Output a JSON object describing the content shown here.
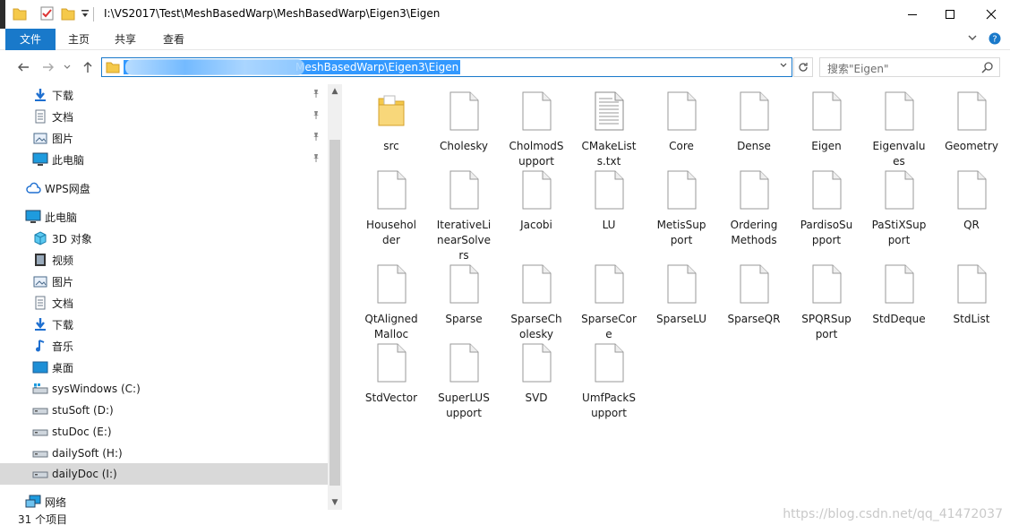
{
  "window": {
    "title": "I:\\VS2017\\Test\\MeshBasedWarp\\MeshBasedWarp\\Eigen3\\Eigen"
  },
  "ribbon": {
    "tabs": [
      "文件",
      "主页",
      "共享",
      "查看"
    ]
  },
  "address": {
    "path_visible": "MeshBasedWarp\\Eigen3\\Eigen"
  },
  "search": {
    "placeholder": "搜索\"Eigen\""
  },
  "sidebar": {
    "quick_access": [
      {
        "label": "下载",
        "icon": "download-arrow-icon"
      },
      {
        "label": "文档",
        "icon": "document-icon"
      },
      {
        "label": "图片",
        "icon": "pictures-icon"
      },
      {
        "label": "此电脑",
        "icon": "computer-icon"
      }
    ],
    "wps": {
      "label": "WPS网盘",
      "icon": "cloud-icon"
    },
    "this_pc": {
      "label": "此电脑",
      "icon": "computer-icon"
    },
    "pc_items": [
      {
        "label": "3D 对象",
        "icon": "3d-objects-icon"
      },
      {
        "label": "视频",
        "icon": "videos-icon"
      },
      {
        "label": "图片",
        "icon": "pictures-icon"
      },
      {
        "label": "文档",
        "icon": "document-icon"
      },
      {
        "label": "下载",
        "icon": "download-arrow-icon"
      },
      {
        "label": "音乐",
        "icon": "music-icon"
      },
      {
        "label": "桌面",
        "icon": "desktop-icon"
      },
      {
        "label": "sysWindows (C:)",
        "icon": "windows-drive-icon"
      },
      {
        "label": "stuSoft (D:)",
        "icon": "drive-icon"
      },
      {
        "label": "stuDoc (E:)",
        "icon": "drive-icon"
      },
      {
        "label": "dailySoft (H:)",
        "icon": "drive-icon"
      },
      {
        "label": "dailyDoc (I:)",
        "icon": "drive-icon"
      }
    ],
    "network": {
      "label": "网络",
      "icon": "network-icon"
    }
  },
  "files": [
    {
      "name": "src",
      "label": "src",
      "type": "folder"
    },
    {
      "name": "Cholesky",
      "label": "Cholesky",
      "type": "file"
    },
    {
      "name": "CholmodSupport",
      "label": "CholmodS upport",
      "type": "file"
    },
    {
      "name": "CMakeLists.txt",
      "label": "CMakeList s.txt",
      "type": "text"
    },
    {
      "name": "Core",
      "label": "Core",
      "type": "file"
    },
    {
      "name": "Dense",
      "label": "Dense",
      "type": "file"
    },
    {
      "name": "Eigen",
      "label": "Eigen",
      "type": "file"
    },
    {
      "name": "Eigenvalues",
      "label": "Eigenvalu es",
      "type": "file"
    },
    {
      "name": "Geometry",
      "label": "Geometry",
      "type": "file"
    },
    {
      "name": "Householder",
      "label": "Househol der",
      "type": "file"
    },
    {
      "name": "IterativeLinearSolvers",
      "label": "IterativeLi nearSolve rs",
      "type": "file"
    },
    {
      "name": "Jacobi",
      "label": "Jacobi",
      "type": "file"
    },
    {
      "name": "LU",
      "label": "LU",
      "type": "file"
    },
    {
      "name": "MetisSupport",
      "label": "MetisSup port",
      "type": "file"
    },
    {
      "name": "OrderingMethods",
      "label": "Ordering Methods",
      "type": "file"
    },
    {
      "name": "PardisoSupport",
      "label": "PardisoSu pport",
      "type": "file"
    },
    {
      "name": "PaStiXSupport",
      "label": "PaStiXSup port",
      "type": "file"
    },
    {
      "name": "QR",
      "label": "QR",
      "type": "file"
    },
    {
      "name": "QtAlignedMalloc",
      "label": "QtAligned Malloc",
      "type": "file"
    },
    {
      "name": "Sparse",
      "label": "Sparse",
      "type": "file"
    },
    {
      "name": "SparseCholesky",
      "label": "SparseCh olesky",
      "type": "file"
    },
    {
      "name": "SparseCore",
      "label": "SparseCor e",
      "type": "file"
    },
    {
      "name": "SparseLU",
      "label": "SparseLU",
      "type": "file"
    },
    {
      "name": "SparseQR",
      "label": "SparseQR",
      "type": "file"
    },
    {
      "name": "SPQRSupport",
      "label": "SPQRSup port",
      "type": "file"
    },
    {
      "name": "StdDeque",
      "label": "StdDeque",
      "type": "file"
    },
    {
      "name": "StdList",
      "label": "StdList",
      "type": "file"
    },
    {
      "name": "StdVector",
      "label": "StdVector",
      "type": "file"
    },
    {
      "name": "SuperLUSupport",
      "label": "SuperLUS upport",
      "type": "file"
    },
    {
      "name": "SVD",
      "label": "SVD",
      "type": "file"
    },
    {
      "name": "UmfPackSupport",
      "label": "UmfPackS upport",
      "type": "file"
    }
  ],
  "status": {
    "count": "31 个项目",
    "watermark": "https://blog.csdn.net/qq_41472037"
  },
  "colors": {
    "accent": "#1979ca",
    "selection": "#3399ff",
    "sidebar_selected": "#d9d9d9",
    "folder": "#f5c94a"
  }
}
